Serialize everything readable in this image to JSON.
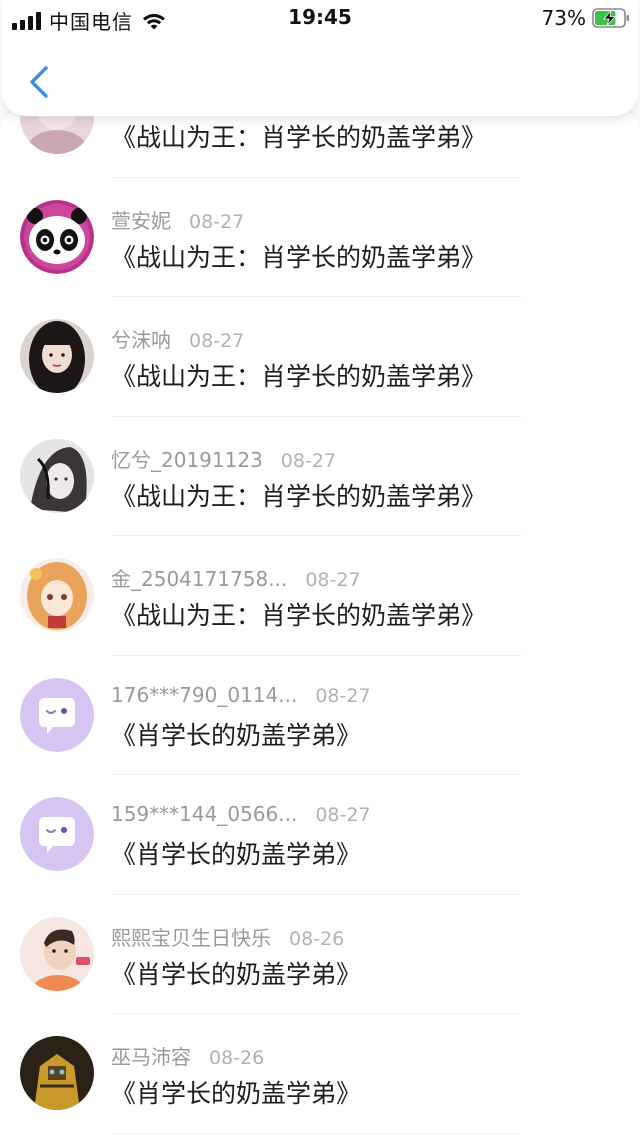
{
  "status_bar": {
    "carrier": "中国电信",
    "time": "19:45",
    "battery": "73%",
    "battery_level": 0.73
  },
  "header": {
    "back_icon": "chevron-left-icon"
  },
  "items": [
    {
      "name": "",
      "date": "",
      "text": "《战山为王：肖学长的奶盖学弟》",
      "avatar": "pink-photo"
    },
    {
      "name": "萱安妮",
      "date": "08-27",
      "text": "《战山为王：肖学长的奶盖学弟》",
      "avatar": "panda"
    },
    {
      "name": "兮沫呐",
      "date": "08-27",
      "text": "《战山为王：肖学长的奶盖学弟》",
      "avatar": "girl-photo"
    },
    {
      "name": "忆兮_20191123",
      "date": "08-27",
      "text": "《战山为王：肖学长的奶盖学弟》",
      "avatar": "sketch"
    },
    {
      "name": "金_2504171758...",
      "date": "08-27",
      "text": "《战山为王：肖学长的奶盖学弟》",
      "avatar": "anime"
    },
    {
      "name": "176***790_0114...",
      "date": "08-27",
      "text": "《肖学长的奶盖学弟》",
      "avatar": "default-chat"
    },
    {
      "name": "159***144_0566...",
      "date": "08-27",
      "text": "《肖学长的奶盖学弟》",
      "avatar": "default-chat"
    },
    {
      "name": "熙熙宝贝生日快乐",
      "date": "08-26",
      "text": "《肖学长的奶盖学弟》",
      "avatar": "boy-photo"
    },
    {
      "name": "巫马沛容",
      "date": "08-26",
      "text": "《肖学长的奶盖学弟》",
      "avatar": "robot"
    }
  ],
  "colors": {
    "accent": "#3b8fe0",
    "default_avatar": "#d6c4f2"
  }
}
